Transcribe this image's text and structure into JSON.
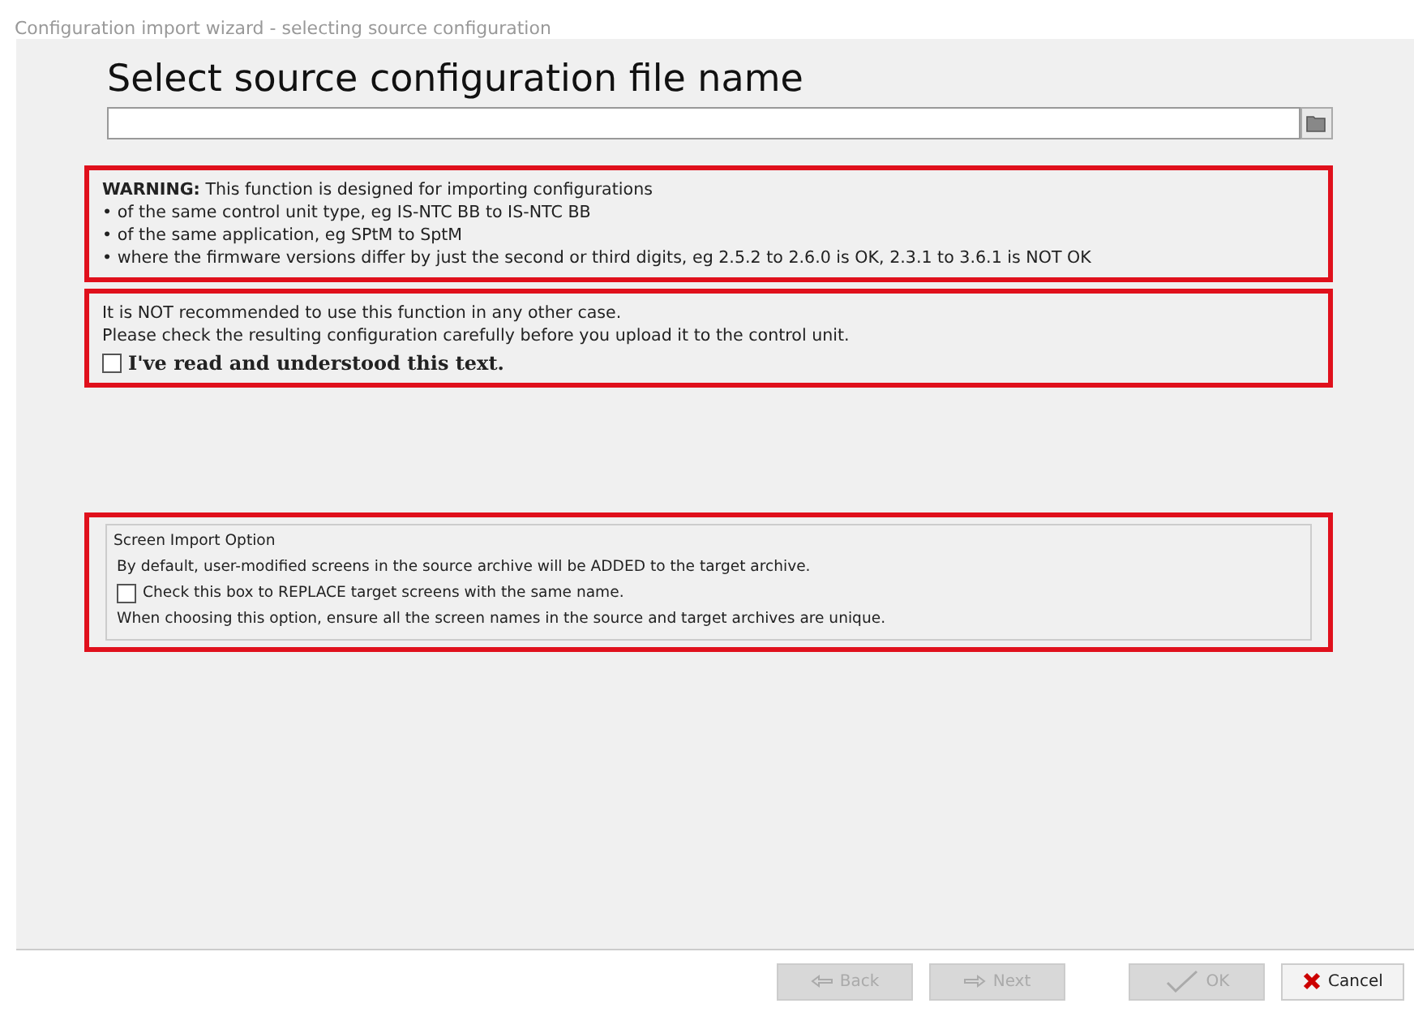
{
  "window": {
    "title": "Configuration import wizard - selecting source configuration"
  },
  "heading": "Select source configuration file name",
  "warning": {
    "lines": [
      "**WARNING:** This function is designed for importing configurations",
      "• of the same control unit type, eg IS-NTC BB to IS-NTC BB",
      "• of the same application, eg SPtM to SptM",
      "• where the firmware versions differ by just the second or third digits, eg 2.5.2 to 2.6.0 is OK, 2.3.1 to 3.6.1 is NOT OK"
    ]
  },
  "notice": {
    "lines": [
      "It is NOT recommended to use this function in any other case.",
      "Please check the resulting configuration carefully before you upload it to the control unit."
    ],
    "checkbox": {
      "label": "I've read and understood this text.",
      "checked": false
    }
  },
  "screen_import": {
    "title": "Screen Import Option",
    "lines_before": [
      "By default, user-modified screens in the source archive will be ADDED to the target archive."
    ],
    "checkbox": {
      "label": "Check this box to REPLACE target screens with the same name.",
      "checked": false
    },
    "lines_after": [
      "When choosing this option, ensure all the screen names in the source and target archives are unique."
    ]
  },
  "buttons": [
    {
      "kind": "back",
      "label": "Back",
      "disabled": true
    },
    {
      "kind": "next",
      "label": "Next",
      "disabled": true
    },
    {
      "kind": "ok",
      "label": "OK",
      "disabled": true
    },
    {
      "kind": "cancel",
      "label": "Cancel",
      "disabled": false
    }
  ]
}
